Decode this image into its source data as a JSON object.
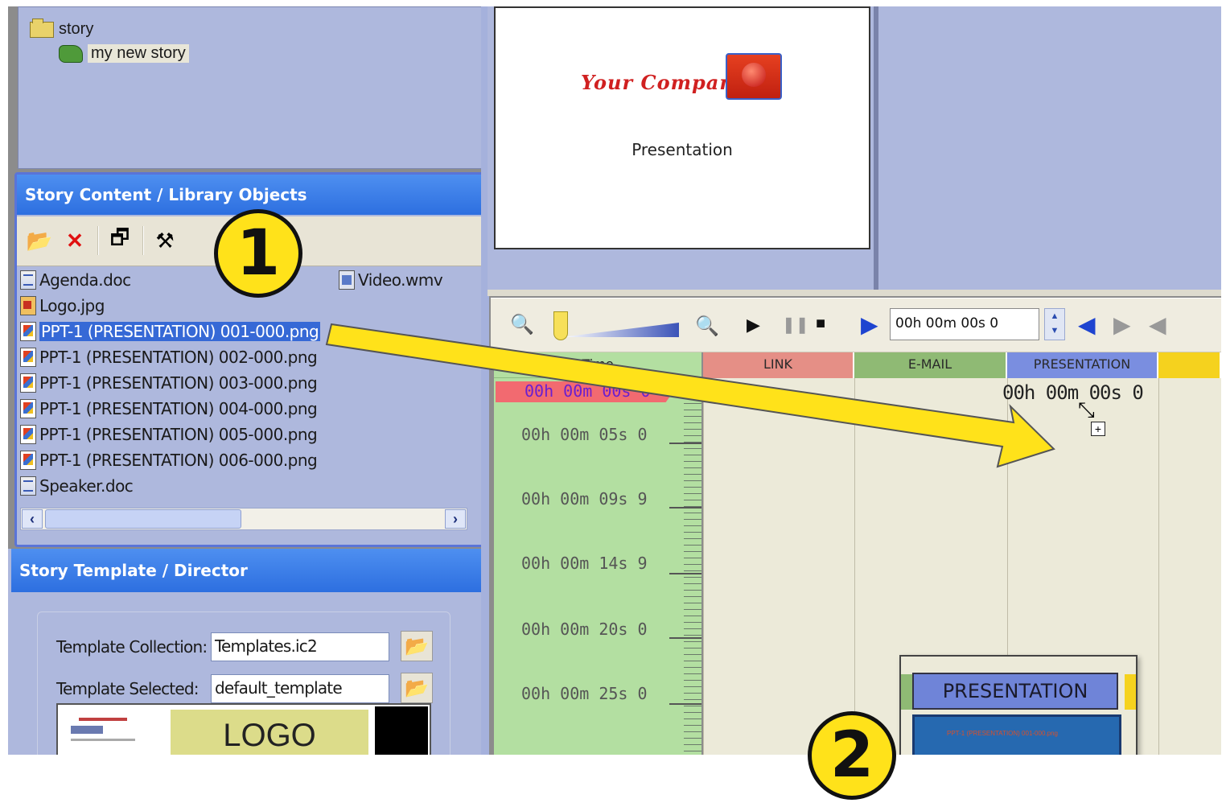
{
  "tree": {
    "root_label": "story",
    "child_label": "my new story"
  },
  "content_panel": {
    "title": "Story Content / Library Objects",
    "files": [
      {
        "name": "Agenda.doc",
        "type": "doc"
      },
      {
        "name": "Logo.jpg",
        "type": "jpg"
      },
      {
        "name": "PPT-1 (PRESENTATION) 001-000.png",
        "type": "png",
        "selected": true
      },
      {
        "name": "PPT-1 (PRESENTATION) 002-000.png",
        "type": "png"
      },
      {
        "name": "PPT-1 (PRESENTATION) 003-000.png",
        "type": "png"
      },
      {
        "name": "PPT-1 (PRESENTATION) 004-000.png",
        "type": "png"
      },
      {
        "name": "PPT-1 (PRESENTATION) 005-000.png",
        "type": "png"
      },
      {
        "name": "PPT-1 (PRESENTATION) 006-000.png",
        "type": "png"
      },
      {
        "name": "Speaker.doc",
        "type": "doc"
      }
    ],
    "side_file": {
      "name": "Video.wmv",
      "type": "wmv"
    }
  },
  "template_panel": {
    "title": "Story Template / Director",
    "collection_label": "Template Collection:",
    "collection_value": "Templates.ic2",
    "selected_label": "Template Selected:",
    "selected_value": "default_template",
    "preview_logo_text": "LOGO"
  },
  "slide_preview": {
    "brand": "Your Company",
    "subtitle": "Presentation"
  },
  "timeline": {
    "time_field": "00h 00m 00s 0",
    "time_header": "Time",
    "current_time": "00h 00m 00s 0",
    "time_labels": [
      "00h 00m 05s 0",
      "00h 00m 09s 9",
      "00h 00m 14s 9",
      "00h 00m 20s 0",
      "00h 00m 25s 0"
    ],
    "tracks": [
      {
        "name": "LINK",
        "color": "#e58f86"
      },
      {
        "name": "E-MAIL",
        "color": "#8fba74"
      },
      {
        "name": "PRESENTATION",
        "color": "#7a8ee0"
      }
    ],
    "drop_time": "00h 00m 00s 0"
  },
  "drag_popup": {
    "title": "PRESENTATION"
  },
  "callouts": {
    "step1": "1",
    "step2": "2"
  },
  "colors": {
    "panel_bg": "#aeb8dd",
    "header_blue": "#2d6fe0",
    "highlight_yellow": "#ffe21a",
    "time_green": "#b3dfa1"
  }
}
